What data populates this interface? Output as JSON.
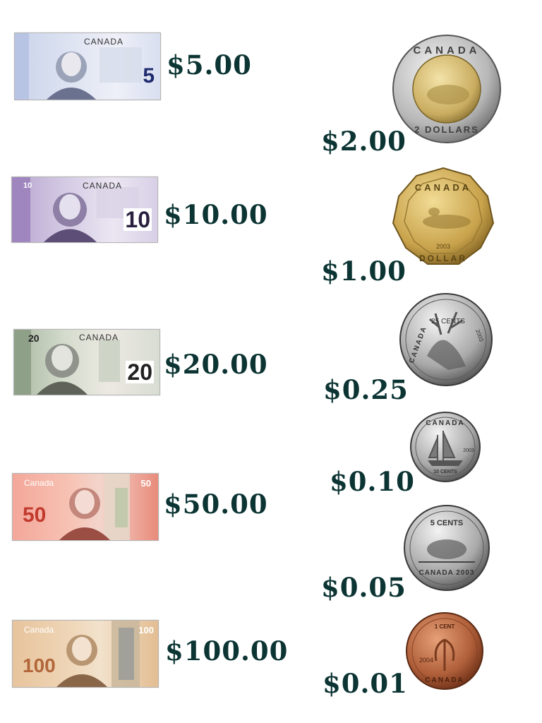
{
  "colors": {
    "price_text": "#0b3433"
  },
  "banknotes": [
    {
      "value_label": "$5.00",
      "country": "CANADA",
      "denomination": "5",
      "icon": "banknote-5-icon"
    },
    {
      "value_label": "$10.00",
      "country": "CANADA",
      "denomination": "10",
      "icon": "banknote-10-icon"
    },
    {
      "value_label": "$20.00",
      "country": "CANADA",
      "denomination": "20",
      "icon": "banknote-20-icon"
    },
    {
      "value_label": "$50.00",
      "country": "Canada",
      "denomination": "50",
      "icon": "banknote-50-icon"
    },
    {
      "value_label": "$100.00",
      "country": "Canada",
      "denomination": "100",
      "icon": "banknote-100-icon"
    }
  ],
  "coins": [
    {
      "value_label": "$2.00",
      "top_text": "CANADA",
      "bottom_text": "2 DOLLARS",
      "icon": "toonie-coin-icon"
    },
    {
      "value_label": "$1.00",
      "top_text": "CANADA",
      "bottom_text": "DOLLAR",
      "year": "2003",
      "icon": "loonie-coin-icon"
    },
    {
      "value_label": "$0.25",
      "top_text": "CANADA",
      "denomination_text": "25 CENTS",
      "year": "2003",
      "icon": "quarter-coin-icon"
    },
    {
      "value_label": "$0.10",
      "top_text": "CANADA",
      "denomination_text": "10 CENTS",
      "year": "2003",
      "icon": "dime-coin-icon"
    },
    {
      "value_label": "$0.05",
      "top_text": "5 CENTS",
      "bottom_text": "CANADA 2003",
      "icon": "nickel-coin-icon"
    },
    {
      "value_label": "$0.01",
      "top_text": "1 CENT",
      "bottom_text": "CANADA",
      "year": "2004",
      "icon": "penny-coin-icon"
    }
  ]
}
